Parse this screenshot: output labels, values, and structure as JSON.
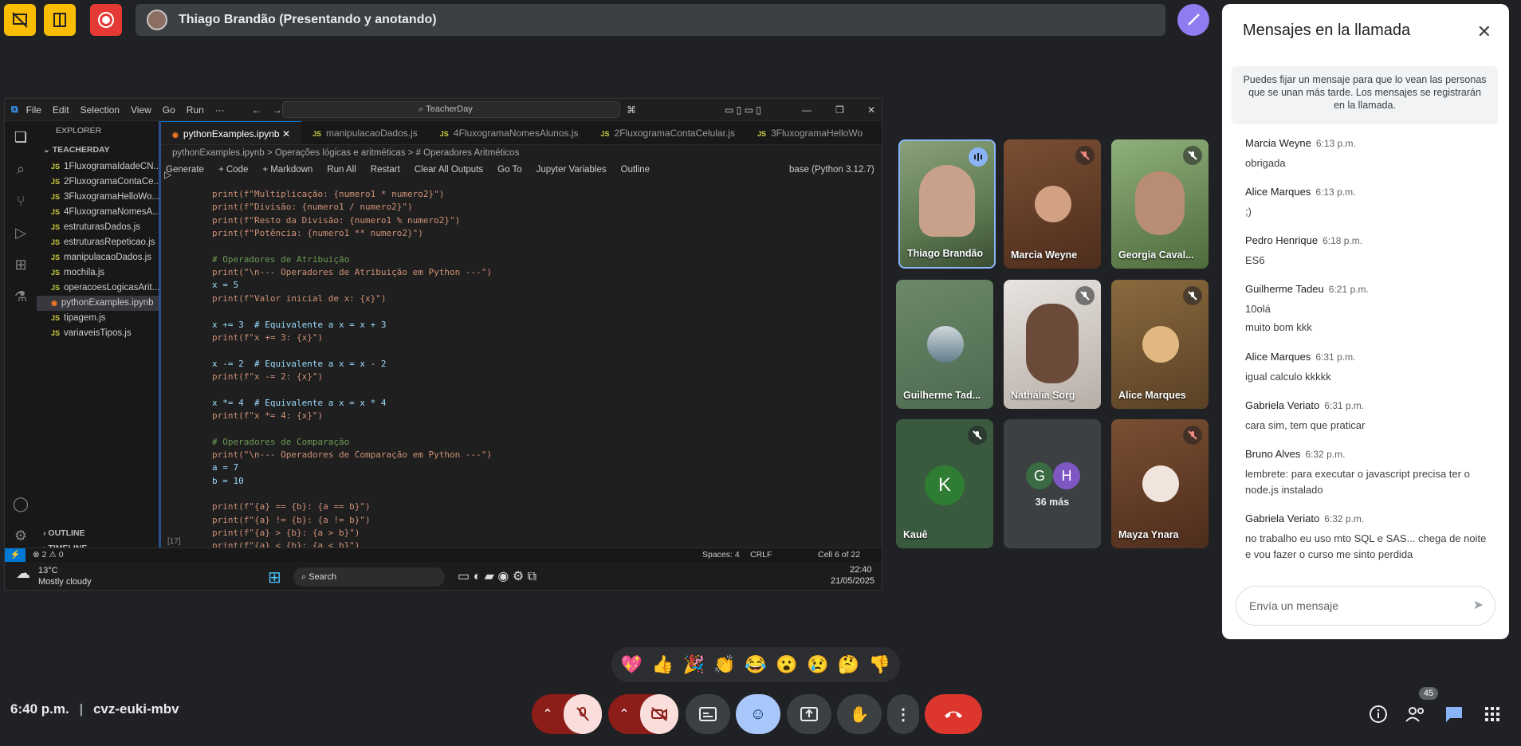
{
  "meet": {
    "presenter_label": "Thiago Brandão (Presentando y anotando)",
    "time": "6:40 p.m.",
    "meeting_code": "cvz-euki-mbv",
    "people_count": "45",
    "colors": {
      "accent": "#8ab4f8",
      "danger": "#ea4335",
      "record": "#e53935",
      "yellow": "#fbbc04"
    }
  },
  "vscode": {
    "menu": [
      "File",
      "Edit",
      "Selection",
      "View",
      "Go",
      "Run"
    ],
    "search": "TeacherDay",
    "explorer_title": "EXPLORER",
    "root": "TEACHERDAY",
    "files": [
      "1FluxogramaIdadeCN...",
      "2FluxogramaContaCe...",
      "3FluxogramaHelloWo...",
      "4FluxogramaNomesA...",
      "estruturasDados.js",
      "estruturasRepeticao.js",
      "manipulacaoDados.js",
      "mochila.js",
      "operacoesLogicasArit...",
      "pythonExamples.ipynb",
      "tipagem.js",
      "variaveisTipos.js"
    ],
    "outline": "OUTLINE",
    "timeline": "TIMELINE",
    "tabs": [
      "pythonExamples.ipynb",
      "manipulacaoDados.js",
      "4FluxogramaNomesAlunos.js",
      "2FluxogramaContaCelular.js",
      "3FluxogramaHelloWo"
    ],
    "breadcrumb": [
      "pythonExamples.ipynb",
      "Operações lógicas e aritméticas",
      "# Operadores Aritméticos"
    ],
    "toolbar": [
      "Generate",
      "+ Code",
      "+ Markdown",
      "Run All",
      "Restart",
      "Clear All Outputs",
      "Go To",
      "Jupyter Variables",
      "Outline"
    ],
    "kernel": "base (Python 3.12.7)",
    "cell_counter": "[17]",
    "status": {
      "errors": "2",
      "warnings": "0",
      "spaces": "Spaces: 4",
      "eol": "CRLF",
      "cell": "Cell 6 of 22"
    },
    "taskbar": {
      "temp": "13°C",
      "weather": "Mostly cloudy",
      "search": "Search",
      "time": "22:40",
      "date": "21/05/2025"
    }
  },
  "code_lines": [
    "print(f\"Multiplicação: {numero1 * numero2}\")",
    "print(f\"Divisão: {numero1 / numero2}\")",
    "print(f\"Resto da Divisão: {numero1 % numero2}\")",
    "print(f\"Potência: {numero1 ** numero2}\")",
    "",
    "# Operadores de Atribuição",
    "print(\"\\n--- Operadores de Atribuição em Python ---\")",
    "x = 5",
    "print(f\"Valor inicial de x: {x}\")",
    "",
    "x += 3  # Equivalente a x = x + 3",
    "print(f\"x += 3: {x}\")",
    "",
    "x -= 2  # Equivalente a x = x - 2",
    "print(f\"x -= 2: {x}\")",
    "",
    "x *= 4  # Equivalente a x = x * 4",
    "print(f\"x *= 4: {x}\")",
    "",
    "# Operadores de Comparação",
    "print(\"\\n--- Operadores de Comparação em Python ---\")",
    "a = 7",
    "b = 10",
    "",
    "print(f\"{a} == {b}: {a == b}\")",
    "print(f\"{a} != {b}: {a != b}\")",
    "print(f\"{a} > {b}: {a > b}\")",
    "print(f\"{a} < {b}: {a < b}\")"
  ],
  "participants": [
    {
      "name": "Thiago Brandão",
      "muted": false
    },
    {
      "name": "Marcia Weyne",
      "muted": true
    },
    {
      "name": "Georgia Caval...",
      "muted": true
    },
    {
      "name": "Guilherme Tad...",
      "muted": false
    },
    {
      "name": "Nathália Sorg",
      "muted": true
    },
    {
      "name": "Alice Marques",
      "muted": true
    },
    {
      "name": "Kauê",
      "muted": true,
      "initial": "K"
    },
    {
      "name": "36 más",
      "initials": [
        "G",
        "H"
      ]
    },
    {
      "name": "Mayza Ynara",
      "muted": true
    }
  ],
  "chat": {
    "title": "Mensajes en la llamada",
    "notice": "Puedes fijar un mensaje para que lo vean las personas que se unan más tarde. Los mensajes se registrarán en la llamada.",
    "messages": [
      {
        "who": "Marcia Weyne",
        "time": "6:13 p.m.",
        "text": "obrigada"
      },
      {
        "who": "Alice Marques",
        "time": "6:13 p.m.",
        "text": ";)"
      },
      {
        "who": "Pedro Henrique",
        "time": "6:18 p.m.",
        "text": "ES6"
      },
      {
        "who": "Guilherme Tadeu",
        "time": "6:21 p.m.",
        "text": "10olá",
        "text2": "muito bom kkk"
      },
      {
        "who": "Alice Marques",
        "time": "6:31 p.m.",
        "text": "igual calculo kkkkk"
      },
      {
        "who": "Gabriela Veriato",
        "time": "6:31 p.m.",
        "text": "cara sim, tem que praticar"
      },
      {
        "who": "Bruno Alves",
        "time": "6:32 p.m.",
        "text": "lembrete: para executar o javascript precisa ter o node.js instalado"
      },
      {
        "who": "Gabriela Veriato",
        "time": "6:32 p.m.",
        "text": "no trabalho eu uso mto SQL e SAS... chega de noite e vou fazer o curso me sinto perdida"
      }
    ],
    "input_placeholder": "Envía un mensaje"
  },
  "emojis": [
    "💖",
    "👍",
    "🎉",
    "👏",
    "😂",
    "😮",
    "😢",
    "🤔",
    "👎"
  ]
}
